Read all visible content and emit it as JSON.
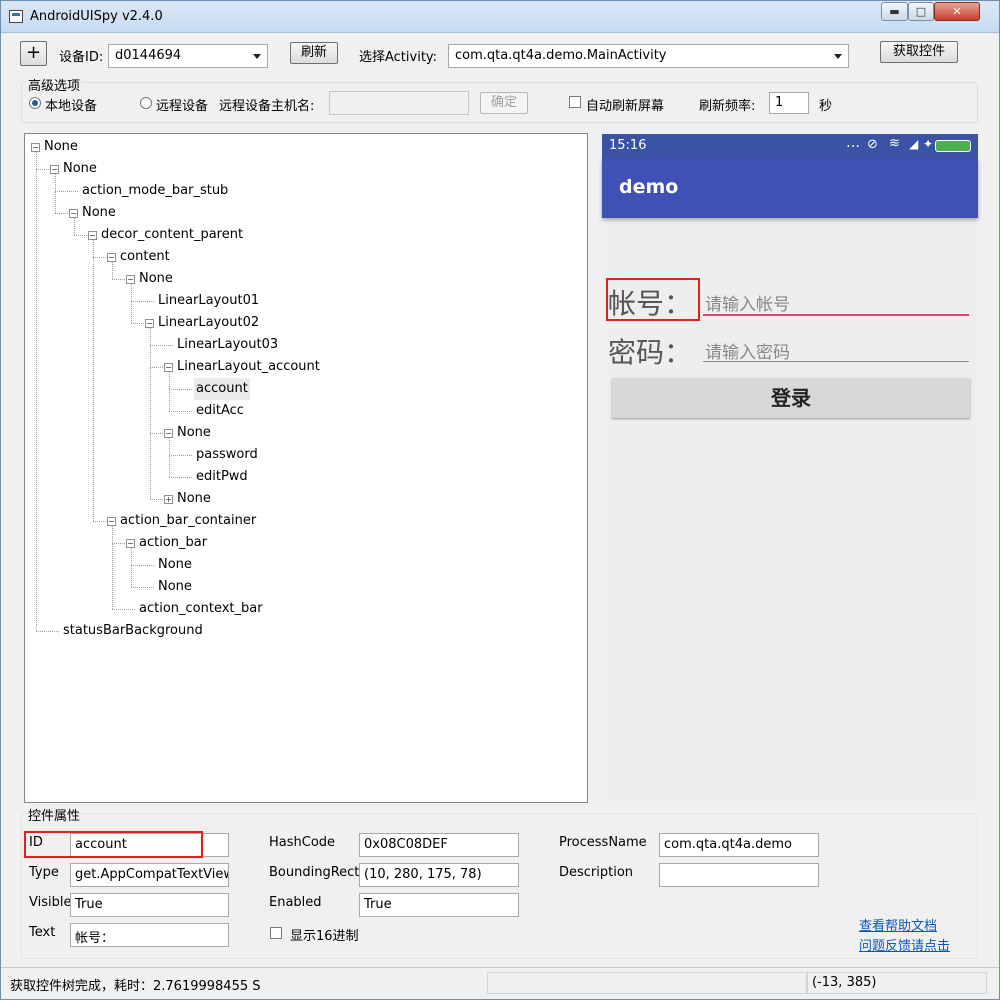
{
  "window": {
    "title": "AndroidUISpy v2.4.0",
    "min_icon": "minimize-icon",
    "max_icon": "maximize-icon",
    "close_icon": "close-icon"
  },
  "toolbar": {
    "add_label": "+",
    "device_id_label": "设备ID:",
    "device_id_value": "d0144694",
    "refresh_label": "刷新",
    "activity_label": "选择Activity:",
    "activity_value": "com.qta.qt4a.demo.MainActivity",
    "get_controls_label": "获取控件"
  },
  "advanced": {
    "group_title": "高级选项",
    "local_device_label": "本地设备",
    "local_device_checked": true,
    "remote_device_label": "远程设备",
    "remote_device_checked": false,
    "remote_host_label": "远程设备主机名:",
    "remote_host_value": "",
    "confirm_label": "确定",
    "auto_refresh_label": "自动刷新屏幕",
    "auto_refresh_checked": false,
    "refresh_rate_label": "刷新频率:",
    "refresh_rate_value": "1",
    "seconds_label": "秒"
  },
  "tree": {
    "nodes": [
      {
        "label": "None",
        "depth": 0,
        "expander": "-"
      },
      {
        "label": "None",
        "depth": 1,
        "expander": "-"
      },
      {
        "label": "action_mode_bar_stub",
        "depth": 2,
        "expander": ""
      },
      {
        "label": "None",
        "depth": 2,
        "expander": "-"
      },
      {
        "label": "decor_content_parent",
        "depth": 3,
        "expander": "-"
      },
      {
        "label": "content",
        "depth": 4,
        "expander": "-"
      },
      {
        "label": "None",
        "depth": 5,
        "expander": "-"
      },
      {
        "label": "LinearLayout01",
        "depth": 6,
        "expander": ""
      },
      {
        "label": "LinearLayout02",
        "depth": 6,
        "expander": "-"
      },
      {
        "label": "LinearLayout03",
        "depth": 7,
        "expander": ""
      },
      {
        "label": "LinearLayout_account",
        "depth": 7,
        "expander": "-"
      },
      {
        "label": "account",
        "depth": 8,
        "expander": "",
        "selected": true
      },
      {
        "label": "editAcc",
        "depth": 8,
        "expander": ""
      },
      {
        "label": "None",
        "depth": 7,
        "expander": "-"
      },
      {
        "label": "password",
        "depth": 8,
        "expander": ""
      },
      {
        "label": "editPwd",
        "depth": 8,
        "expander": ""
      },
      {
        "label": "None",
        "depth": 7,
        "expander": "+"
      },
      {
        "label": "action_bar_container",
        "depth": 4,
        "expander": "-"
      },
      {
        "label": "action_bar",
        "depth": 5,
        "expander": "-"
      },
      {
        "label": "None",
        "depth": 6,
        "expander": ""
      },
      {
        "label": "None",
        "depth": 6,
        "expander": ""
      },
      {
        "label": "action_context_bar",
        "depth": 5,
        "expander": ""
      },
      {
        "label": "statusBarBackground",
        "depth": 1,
        "expander": ""
      }
    ]
  },
  "phone": {
    "time": "15:16",
    "status_icons": [
      "more-dots-icon",
      "rotate-lock-icon",
      "wifi-icon",
      "signal-icon",
      "battery-icon"
    ],
    "app_title": "demo",
    "account_label": "帐号：",
    "account_hint": "请输入帐号",
    "password_label": "密码：",
    "password_hint": "请输入密码",
    "login_label": "登录",
    "appbar_color": "#3f51b5",
    "statusbar_color": "#3a53a4",
    "focus_color": "#e0457a",
    "highlight_color": "#e02020"
  },
  "properties": {
    "group_title": "控件属性",
    "id_label": "ID",
    "id_value": "account",
    "type_label": "Type",
    "type_value": "get.AppCompatTextView",
    "visible_label": "Visible",
    "visible_value": "True",
    "text_label": "Text",
    "text_value": "帐号：",
    "hashcode_label": "HashCode",
    "hashcode_value": "0x08C08DEF",
    "bounding_label": "BoundingRect",
    "bounding_value": "(10, 280, 175, 78)",
    "enabled_label": "Enabled",
    "enabled_value": "True",
    "hex_label": "显示16进制",
    "hex_checked": false,
    "process_label": "ProcessName",
    "process_value": "com.qta.qt4a.demo",
    "description_label": "Description",
    "description_value": "",
    "help_link": "查看帮助文档",
    "feedback_link": "问题反馈请点击"
  },
  "status": {
    "message": "获取控件树完成，耗时：2.7619998455 S",
    "coords": "(-13, 385)"
  }
}
